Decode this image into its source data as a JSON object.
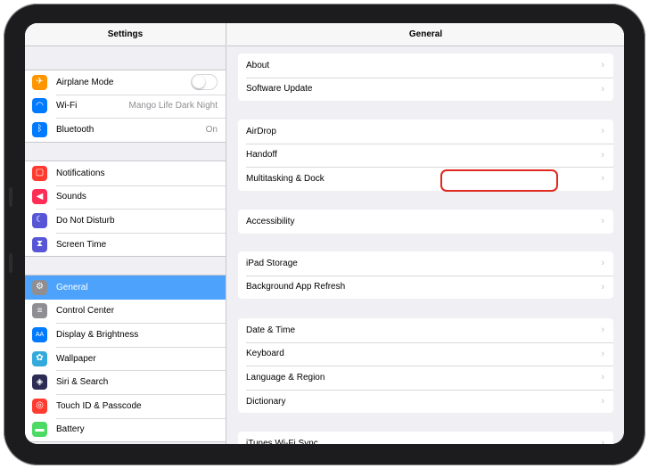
{
  "sidebar": {
    "title": "Settings",
    "group1": [
      {
        "label": "Airplane Mode",
        "icon": "airplane-icon",
        "color": "#ff9500",
        "glyph": "✈",
        "toggle": false
      },
      {
        "label": "Wi-Fi",
        "icon": "wifi-icon",
        "color": "#007aff",
        "glyph": "◠",
        "value": "Mango Life Dark Night"
      },
      {
        "label": "Bluetooth",
        "icon": "bluetooth-icon",
        "color": "#007aff",
        "glyph": "ᛒ",
        "value": "On"
      }
    ],
    "group2": [
      {
        "label": "Notifications",
        "icon": "notifications-icon",
        "color": "#ff3b30",
        "glyph": "▢"
      },
      {
        "label": "Sounds",
        "icon": "speaker-icon",
        "color": "#ff2d55",
        "glyph": "◀"
      },
      {
        "label": "Do Not Disturb",
        "icon": "moon-icon",
        "color": "#5856d6",
        "glyph": "☾"
      },
      {
        "label": "Screen Time",
        "icon": "hourglass-icon",
        "color": "#5856d6",
        "glyph": "⧗"
      }
    ],
    "group3": [
      {
        "label": "General",
        "icon": "gear-icon",
        "color": "#8e8e93",
        "glyph": "⚙",
        "selected": true
      },
      {
        "label": "Control Center",
        "icon": "switches-icon",
        "color": "#8e8e93",
        "glyph": "≡"
      },
      {
        "label": "Display & Brightness",
        "icon": "text-size-icon",
        "color": "#007aff",
        "glyph": "AA"
      },
      {
        "label": "Wallpaper",
        "icon": "flower-icon",
        "color": "#34aadc",
        "glyph": "✿"
      },
      {
        "label": "Siri & Search",
        "icon": "siri-icon",
        "color": "#2c2c54",
        "glyph": "◈"
      },
      {
        "label": "Touch ID & Passcode",
        "icon": "fingerprint-icon",
        "color": "#ff3b30",
        "glyph": "◎"
      },
      {
        "label": "Battery",
        "icon": "battery-icon",
        "color": "#4cd964",
        "glyph": "▬"
      }
    ]
  },
  "detail": {
    "title": "General",
    "sections": [
      [
        "About",
        "Software Update"
      ],
      [
        "AirDrop",
        "Handoff",
        "Multitasking & Dock"
      ],
      [
        "Accessibility"
      ],
      [
        "iPad Storage",
        "Background App Refresh"
      ],
      [
        "Date & Time",
        "Keyboard",
        "Language & Region",
        "Dictionary"
      ],
      [
        "iTunes Wi-Fi Sync"
      ]
    ],
    "highlighted": "Multitasking & Dock",
    "highlight_color": "#e0281f"
  },
  "colors": {
    "selection": "#4da3fb",
    "background": "#efeff4"
  }
}
